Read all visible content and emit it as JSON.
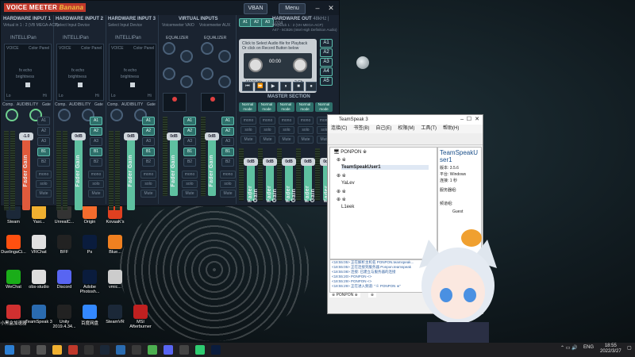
{
  "voicemeeter": {
    "logo_main": "VOICE MEETER",
    "logo_sub": "Banana",
    "vban": "VBAN",
    "menu": "Menu",
    "hw_out_title": "HARDWARE OUT",
    "hw_out_freq": "48kHz | 1024",
    "hw_out_line1": "Playback 1 : 2 (VH MEGA-ACP)",
    "hw_out_line2": "A47 - 5CB26 (Intel High Definition Audio)",
    "a_buttons": [
      "A1",
      "A2",
      "A3"
    ],
    "intelli": "INTELLIPan",
    "voice": "VOICE",
    "color_panel": "Color Panel",
    "fx_echo": "fx echo",
    "brightness": "brightness",
    "lofi": "Lo",
    "hifi": "Hi",
    "comp": "Comp.",
    "audibility": "AUDIBILITY",
    "gate": "Gate",
    "fader_gain": "Fader Gain",
    "bus_labels": [
      "A1",
      "A2",
      "A3",
      "B1",
      "B2"
    ],
    "mono": "mono",
    "solo": "solo",
    "mute": "Mute",
    "inputs": [
      {
        "title": "HARDWARE INPUT 1",
        "device": "Virtual in 1 : 2 (VB MEGA-ACP)",
        "gain": "-1.0",
        "color": "#e05a3c"
      },
      {
        "title": "HARDWARE INPUT 2",
        "device": "Select Input Device",
        "gain": "0dB",
        "color": "#5ec0a0"
      },
      {
        "title": "HARDWARE INPUT 3",
        "device": "Select Input Device",
        "gain": "0dB",
        "color": "#5ec0a0"
      }
    ],
    "virtual": {
      "title": "VIRTUAL INPUTS",
      "labels": [
        "Voicemeeter VAIO",
        "Voicemeeter AUX"
      ],
      "eq": "EQUALIZER",
      "treble": "Treble",
      "bass": "Bass",
      "gain": "0dB"
    },
    "cassette": {
      "label1": "Click to Select Audio file for Playback",
      "label2": "Or click on Record Button below",
      "time": "00:00",
      "freq": "44100 Hz",
      "ch": "2 Ch",
      "in": "input",
      "out": "out"
    },
    "a_side": [
      "A1",
      "A2",
      "A3",
      "A4",
      "A5"
    ],
    "master": {
      "title": "MASTER SECTION",
      "mode_label": "Normal mode",
      "strips": [
        "A1",
        "A2",
        "A3",
        "A4",
        "A5",
        "B1",
        "B2",
        "B3"
      ],
      "gain": "0dB"
    }
  },
  "teamspeak": {
    "title": "TeamSpeak 3",
    "menus": [
      "连接(C)",
      "书签(B)",
      "自己(E)",
      "权限(M)",
      "工具(T)",
      "帮助(H)"
    ],
    "server": "PONPON ※",
    "tree": [
      {
        "text": "⊕ ※",
        "bold": false
      },
      {
        "text": "TeamSpeakUser1",
        "bold": true
      },
      {
        "text": "⊕ ※",
        "bold": false
      },
      {
        "text": "YaLev",
        "bold": false
      },
      {
        "text": "⊕ ※",
        "bold": false
      },
      {
        "text": "⊕ ※",
        "bold": false
      },
      {
        "text": "L1eek",
        "bold": false
      }
    ],
    "info_name": "TeamSpeakUser1",
    "info_rows": [
      "版本: 3.5.6",
      "平台: Windows",
      "连接: 1 秒"
    ],
    "server_groups": "服务器组:",
    "channel_group": "频道组:",
    "guest": "Guest",
    "chat": [
      "<18:55:05> 正在解析主机名 PONPON.teamspeak...",
      "<18:55:05> 正在连接到服务器 Ponpon.teamspeak",
      "<18:55:08> 连接: 已建立与服务器的连接",
      "<18:55:20> PONPON·<>",
      "<18:55:29> PONPON·<>",
      "<18:55:29> 正在进入频道: \"※ PONPON ※\""
    ],
    "tabs": [
      "※ PONPON ※",
      "※"
    ]
  },
  "desktop_icons": [
    {
      "label": "Steam",
      "color": "#1b2838"
    },
    {
      "label": "Yasi...",
      "color": "#f0b030"
    },
    {
      "label": "UnrealC...",
      "color": "#333333"
    },
    {
      "label": "Origin",
      "color": "#f56c2d"
    },
    {
      "label": "KovaaK's",
      "color": "#e04020"
    },
    {
      "label": "DuelingaCi...",
      "color": "#ff5010"
    },
    {
      "label": "VRChat",
      "color": "#e0e0e0"
    },
    {
      "label": "BFF",
      "color": "#222222"
    },
    {
      "label": "Ps",
      "color": "#0a1c3d"
    },
    {
      "label": "Blue...",
      "color": "#f08020"
    },
    {
      "label": "WeChat",
      "color": "#1aad19"
    },
    {
      "label": "obs-studio",
      "color": "#dddddd"
    },
    {
      "label": "Discord",
      "color": "#5865f2"
    },
    {
      "label": "Adobe Photosh...",
      "color": "#0a1c3d"
    },
    {
      "label": "vmic...",
      "color": "#cccccc"
    },
    {
      "label": "小黑盒加速器",
      "color": "#d03030"
    },
    {
      "label": "TeamSpeak 3",
      "color": "#2a6bb0"
    },
    {
      "label": "Unity 2019.4.34...",
      "color": "#222222"
    },
    {
      "label": "百度网盘",
      "color": "#3388ff"
    },
    {
      "label": "SteamVR",
      "color": "#1b2838"
    },
    {
      "label": "MSI Afterburner",
      "color": "#c02020"
    }
  ],
  "taskbar": {
    "lang": "ENG",
    "time": "18:55",
    "date": "2022/3/27"
  }
}
